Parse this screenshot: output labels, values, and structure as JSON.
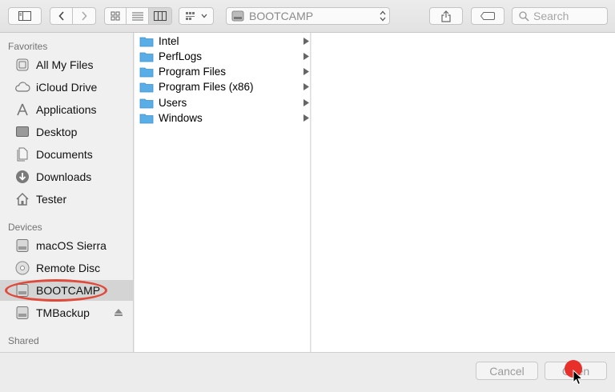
{
  "toolbar": {
    "path_label": "BOOTCAMP",
    "search_placeholder": "Search",
    "icons": [
      "sidebar-toggle-icon",
      "chevron-left-icon",
      "chevron-right-icon",
      "icon-view-icon",
      "list-view-icon",
      "column-view-icon",
      "group-icon",
      "share-icon",
      "tag-icon",
      "magnifier-icon"
    ]
  },
  "sidebar": {
    "favorites_header": "Favorites",
    "favorites": [
      {
        "label": "All My Files",
        "icon": "all-files-icon"
      },
      {
        "label": "iCloud Drive",
        "icon": "cloud-icon"
      },
      {
        "label": "Applications",
        "icon": "applications-icon"
      },
      {
        "label": "Desktop",
        "icon": "desktop-icon"
      },
      {
        "label": "Documents",
        "icon": "documents-icon"
      },
      {
        "label": "Downloads",
        "icon": "downloads-icon"
      },
      {
        "label": "Tester",
        "icon": "home-icon"
      }
    ],
    "devices_header": "Devices",
    "devices": [
      {
        "label": "macOS Sierra",
        "icon": "disk-icon"
      },
      {
        "label": "Remote Disc",
        "icon": "disc-icon"
      },
      {
        "label": "BOOTCAMP",
        "icon": "disk-icon",
        "selected": true
      },
      {
        "label": "TMBackup",
        "icon": "disk-icon",
        "ejectable": true
      }
    ],
    "shared_header": "Shared"
  },
  "column1": {
    "items": [
      "Intel",
      "PerfLogs",
      "Program Files",
      "Program Files (x86)",
      "Users",
      "Windows"
    ]
  },
  "bottom": {
    "cancel_label": "Cancel",
    "open_label": "Open"
  },
  "colors": {
    "folder": "#5aaee8",
    "highlight": "#e04a3a"
  }
}
